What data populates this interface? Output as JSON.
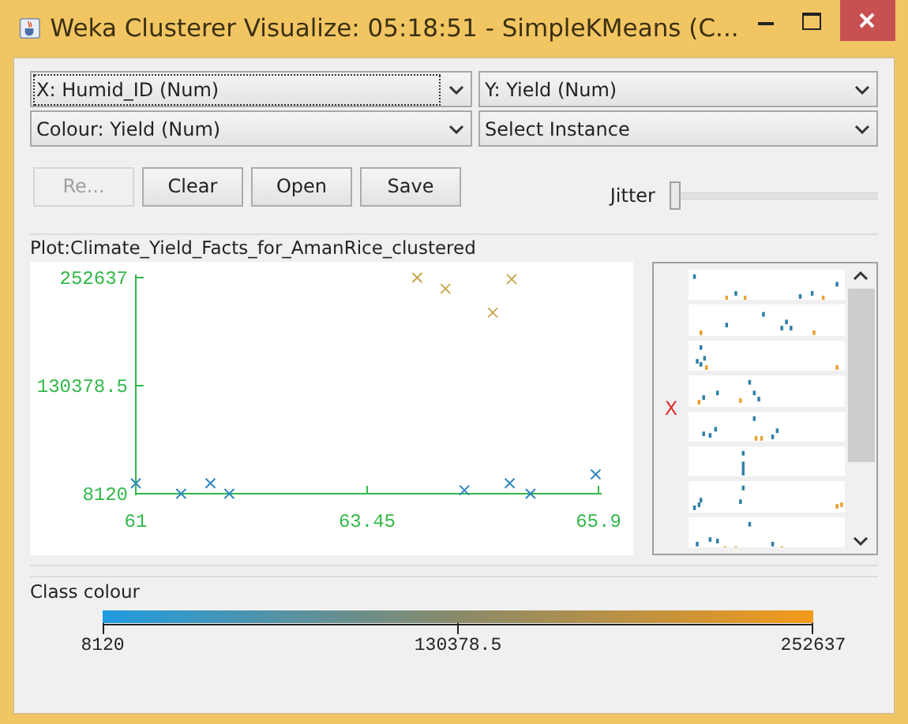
{
  "window": {
    "title": "Weka Clusterer Visualize: 05:18:51 - SimpleKMeans (C..."
  },
  "selectors": [
    {
      "label": "X: Humid_ID (Num)",
      "focused": true
    },
    {
      "label": "Y: Yield (Num)",
      "focused": false
    },
    {
      "label": "Colour: Yield (Num)",
      "focused": false
    },
    {
      "label": "Select Instance",
      "focused": false
    }
  ],
  "buttons": [
    {
      "label": "Re...",
      "disabled": true
    },
    {
      "label": "Clear",
      "disabled": false
    },
    {
      "label": "Open",
      "disabled": false
    },
    {
      "label": "Save",
      "disabled": false
    }
  ],
  "jitter": {
    "label": "Jitter",
    "level": 0
  },
  "plot": {
    "title": "Plot:Climate_Yield_Facts_for_AmanRice_clustered",
    "chart_data": {
      "type": "scatter",
      "x": [
        61,
        61.48,
        61.79,
        61.99,
        63.98,
        64.28,
        64.98,
        64.78,
        64.48,
        64.96,
        65.18,
        65.87
      ],
      "series": [
        {
          "color": "#2f86bd",
          "values": [
            20000,
            8120,
            20000,
            8120,
            null,
            null,
            null,
            null,
            12000,
            20000,
            8120,
            30000
          ]
        },
        {
          "color": "#c8a850",
          "values": [
            null,
            null,
            null,
            null,
            252637,
            240000,
            251000,
            213000,
            null,
            null,
            null,
            null
          ]
        }
      ],
      "xlim": [
        61,
        65.9
      ],
      "ylim": [
        8120,
        252637
      ],
      "xticks": [
        61,
        63.45,
        65.9
      ],
      "yticks": [
        8120,
        130378.5,
        252637
      ]
    }
  },
  "matrix": {
    "marker": "X"
  },
  "class_colour": {
    "title": "Class colour",
    "ticks": [
      "8120",
      "130378.5",
      "252637"
    ]
  }
}
